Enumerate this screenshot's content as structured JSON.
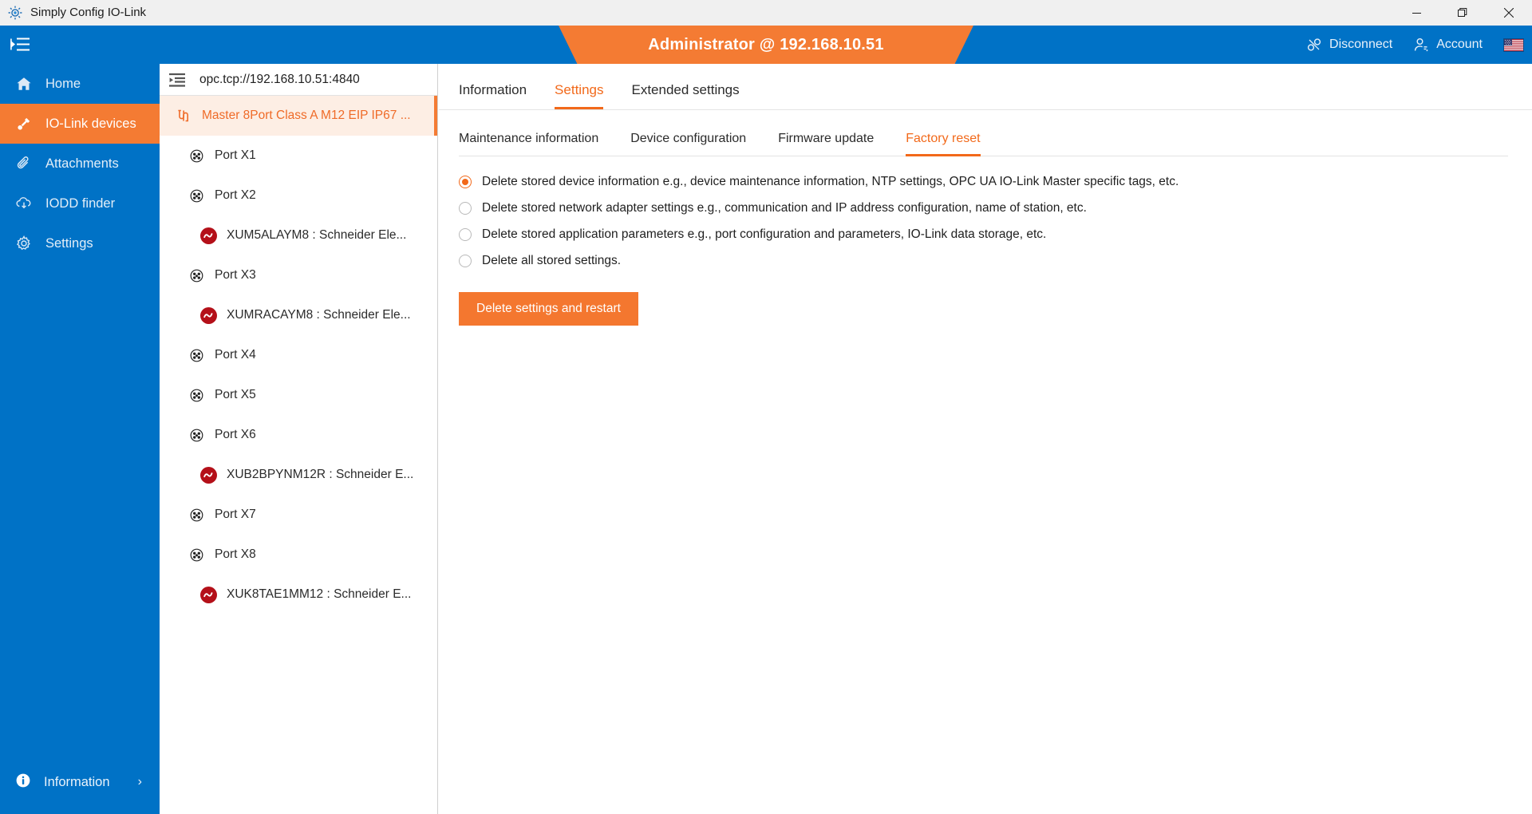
{
  "window": {
    "title": "Simply Config IO-Link",
    "app_icon": "gear-app-icon",
    "minimize_label": "—",
    "maximize_label": "❐",
    "close_label": "✕"
  },
  "topbar": {
    "menu_icon": "hamburger-collapse-icon",
    "banner_text": "Administrator @ 192.168.10.51",
    "disconnect_label": "Disconnect",
    "account_label": "Account",
    "language_flag": "us-flag-icon",
    "blue": "#0072c6",
    "orange": "#f47b33"
  },
  "sidebar": {
    "items": [
      {
        "label": "Home",
        "icon": "home-icon",
        "active": false
      },
      {
        "label": "IO-Link devices",
        "icon": "io-link-plug-icon",
        "active": true
      },
      {
        "label": "Attachments",
        "icon": "paperclip-icon",
        "active": false
      },
      {
        "label": "IODD finder",
        "icon": "cloud-download-icon",
        "active": false
      },
      {
        "label": "Settings",
        "icon": "gear-icon",
        "active": false
      }
    ],
    "bottom": {
      "label": "Information",
      "icon": "info-circle-icon",
      "chevron": "›"
    }
  },
  "tree": {
    "collapse_icon": "collapse-panel-icon",
    "url": "opc.tcp://192.168.10.51:4840",
    "rows": [
      {
        "label": "Master 8Port Class A M12 EIP IP67 ...",
        "icon": "master-link-icon",
        "kind": "master",
        "indent": 1,
        "selected": true
      },
      {
        "label": "Port X1",
        "icon": "m12-port-icon",
        "kind": "port",
        "indent": 2,
        "selected": false
      },
      {
        "label": "Port X2",
        "icon": "m12-port-icon",
        "kind": "port",
        "indent": 2,
        "selected": false
      },
      {
        "label": "XUM5ALAYM8 : Schneider Ele...",
        "icon": "io-link-device-icon",
        "kind": "device",
        "indent": 3,
        "selected": false
      },
      {
        "label": "Port X3",
        "icon": "m12-port-icon",
        "kind": "port",
        "indent": 2,
        "selected": false
      },
      {
        "label": "XUMRACAYM8 : Schneider Ele...",
        "icon": "io-link-device-icon",
        "kind": "device",
        "indent": 3,
        "selected": false
      },
      {
        "label": "Port X4",
        "icon": "m12-port-icon",
        "kind": "port",
        "indent": 2,
        "selected": false
      },
      {
        "label": "Port X5",
        "icon": "m12-port-icon",
        "kind": "port",
        "indent": 2,
        "selected": false
      },
      {
        "label": "Port X6",
        "icon": "m12-port-icon",
        "kind": "port",
        "indent": 2,
        "selected": false
      },
      {
        "label": "XUB2BPYNM12R : Schneider E...",
        "icon": "io-link-device-icon",
        "kind": "device",
        "indent": 3,
        "selected": false
      },
      {
        "label": "Port X7",
        "icon": "m12-port-icon",
        "kind": "port",
        "indent": 2,
        "selected": false
      },
      {
        "label": "Port X8",
        "icon": "m12-port-icon",
        "kind": "port",
        "indent": 2,
        "selected": false
      },
      {
        "label": "XUK8TAE1MM12 : Schneider E...",
        "icon": "io-link-device-icon",
        "kind": "device",
        "indent": 3,
        "selected": false
      }
    ]
  },
  "main": {
    "tabs": [
      {
        "label": "Information",
        "active": false
      },
      {
        "label": "Settings",
        "active": true
      },
      {
        "label": "Extended settings",
        "active": false
      }
    ],
    "subtabs": [
      {
        "label": "Maintenance information",
        "active": false
      },
      {
        "label": "Device configuration",
        "active": false
      },
      {
        "label": "Firmware update",
        "active": false
      },
      {
        "label": "Factory reset",
        "active": true
      }
    ],
    "factory_reset": {
      "options": [
        {
          "label": "Delete stored device information e.g., device maintenance information, NTP settings, OPC UA IO-Link Master specific tags, etc.",
          "selected": true
        },
        {
          "label": "Delete stored network adapter settings e.g., communication and IP address configuration, name of station, etc.",
          "selected": false
        },
        {
          "label": "Delete stored application parameters e.g., port configuration and parameters, IO-Link data storage, etc.",
          "selected": false
        },
        {
          "label": "Delete all stored settings.",
          "selected": false
        }
      ],
      "submit_label": "Delete settings and restart"
    }
  },
  "colors": {
    "accent_orange": "#f2691a",
    "brand_blue": "#0072c6",
    "device_red": "#b41019"
  }
}
